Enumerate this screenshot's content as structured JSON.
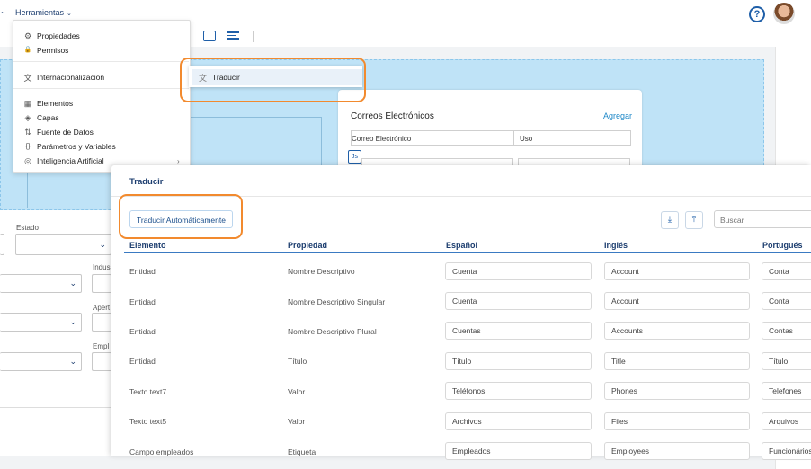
{
  "topbar": {
    "menu_label": "Herramientas",
    "menu_chevron": "⌄",
    "left_chevron": "⌄",
    "help_glyph": "?"
  },
  "dropdown": {
    "items": [
      {
        "label": "Propiedades",
        "icon": "gear-icon",
        "glyph": "⚙"
      },
      {
        "label": "Permisos",
        "icon": "lock-icon",
        "glyph": "🔒"
      },
      {
        "label": "Internacionalización",
        "icon": "translate-icon",
        "glyph": "文"
      },
      {
        "label": "Elementos",
        "icon": "grid-icon",
        "glyph": "▦"
      },
      {
        "label": "Capas",
        "icon": "layers-icon",
        "glyph": "◈"
      },
      {
        "label": "Fuente de Datos",
        "icon": "datasource-icon",
        "glyph": "⇅"
      },
      {
        "label": "Parámetros y Variables",
        "icon": "braces-icon",
        "glyph": "{}"
      },
      {
        "label": "Inteligencia Artificial",
        "icon": "ai-icon",
        "glyph": "◎"
      }
    ],
    "submenu_arrow": "›"
  },
  "submenu": {
    "label": "Traducir",
    "glyph": "文"
  },
  "email_card": {
    "title": "Correos Electrónicos",
    "add_label": "Agregar",
    "columns": [
      "Correo Electrónico",
      "Uso"
    ],
    "badge": "Js"
  },
  "background_form": {
    "estado_label": "Estado",
    "indus_label": "Indus",
    "aper_label": "Apert",
    "empl_label": "Empl",
    "chevron": "⌄"
  },
  "panel": {
    "title": "Traducir",
    "auto_button": "Traducir Automáticamente",
    "download_glyph": "⤓",
    "upload_glyph": "⤒",
    "search_placeholder": "Buscar",
    "columns": [
      "Elemento",
      "Propiedad",
      "Español",
      "Inglés",
      "Portugués"
    ],
    "rows": [
      {
        "elemento": "Entidad",
        "propiedad": "Nombre Descriptivo",
        "es": "Cuenta",
        "en": "Account",
        "pt": "Conta"
      },
      {
        "elemento": "Entidad",
        "propiedad": "Nombre Descriptivo Singular",
        "es": "Cuenta",
        "en": "Account",
        "pt": "Conta"
      },
      {
        "elemento": "Entidad",
        "propiedad": "Nombre Descriptivo Plural",
        "es": "Cuentas",
        "en": "Accounts",
        "pt": "Contas"
      },
      {
        "elemento": "Entidad",
        "propiedad": "Título",
        "es": "Título",
        "en": "Title",
        "pt": "Título"
      },
      {
        "elemento": "Texto text7",
        "propiedad": "Valor",
        "es": "Teléfonos",
        "en": "Phones",
        "pt": "Telefones"
      },
      {
        "elemento": "Texto text5",
        "propiedad": "Valor",
        "es": "Archivos",
        "en": "Files",
        "pt": "Arquivos"
      },
      {
        "elemento": "Campo empleados",
        "propiedad": "Etiqueta",
        "es": "Empleados",
        "en": "Employees",
        "pt": "Funcionários"
      }
    ]
  },
  "colors": {
    "accent": "#1f5fa8",
    "highlight": "#f28a2e",
    "canvas_blue": "#bfe3f7"
  }
}
